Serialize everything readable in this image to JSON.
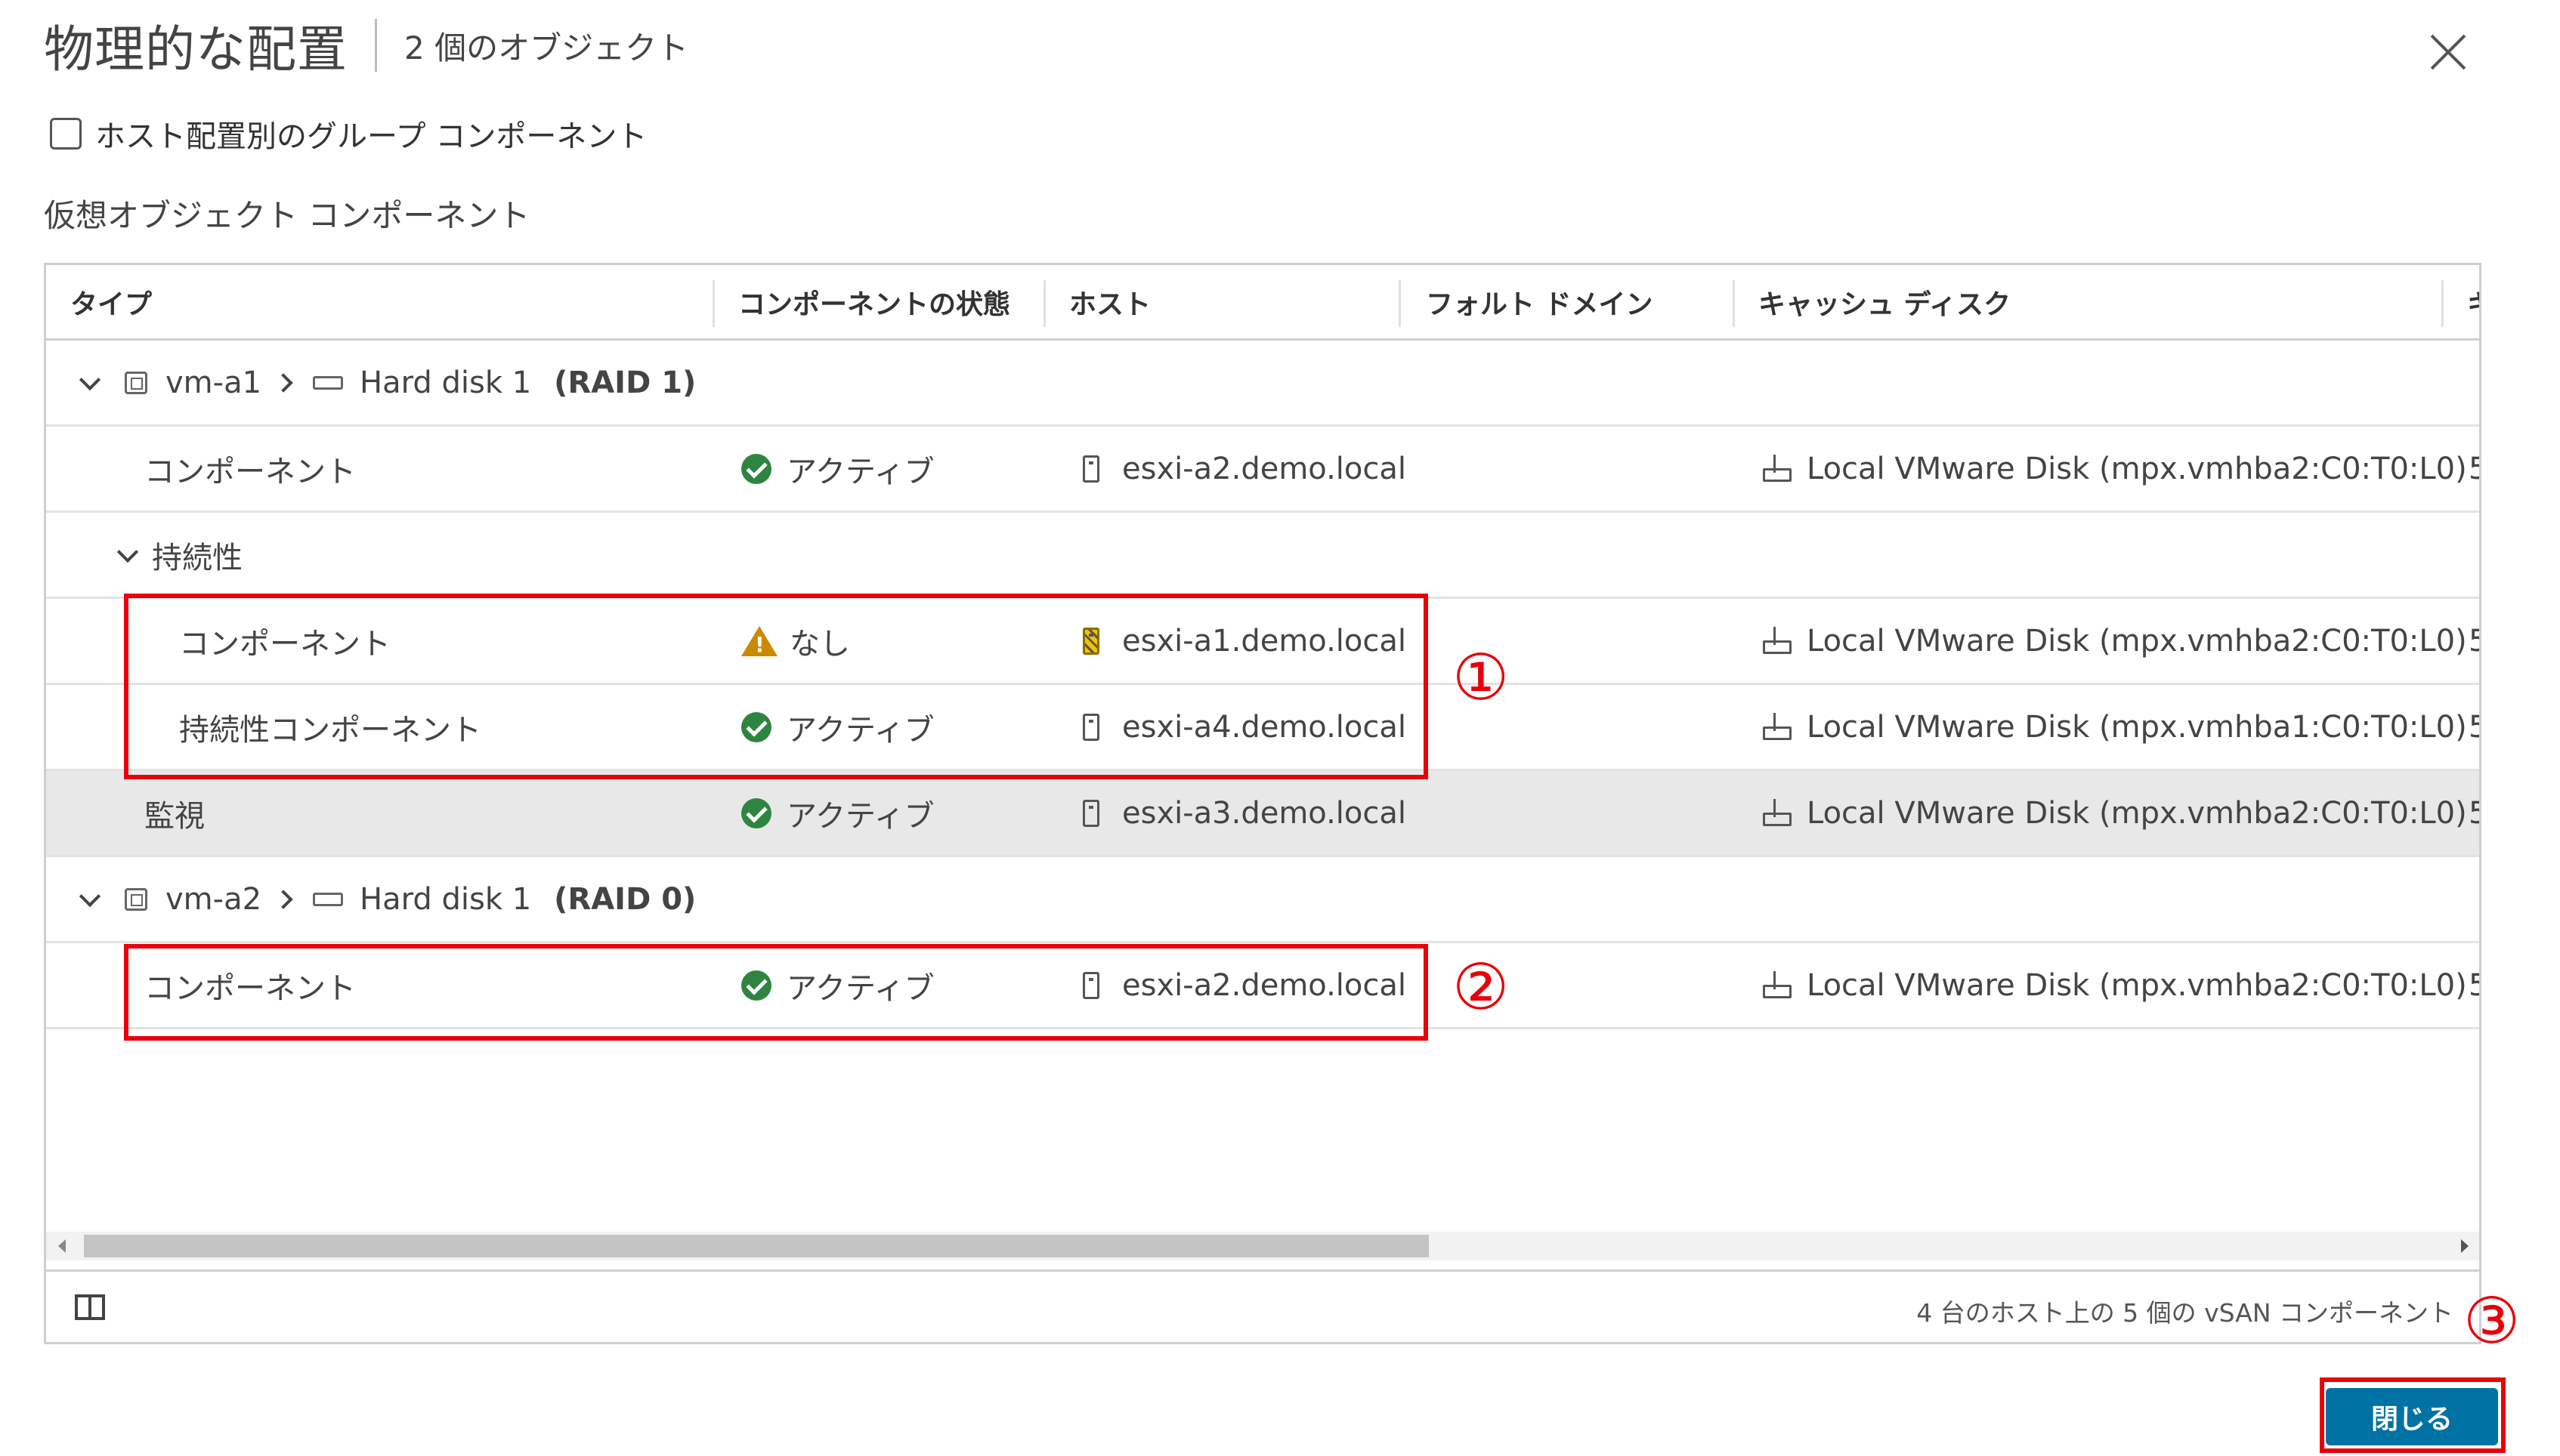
{
  "dialog": {
    "title": "物理的な配置",
    "subtitle": "2 個のオブジェクト",
    "group_by_host_label": "ホスト配置別のグループ コンポーネント",
    "section_label": "仮想オブジェクト コンポーネント",
    "close_button": "閉じる"
  },
  "table": {
    "columns": [
      "タイプ",
      "コンポーネントの状態",
      "ホスト",
      "フォルト ドメイン",
      "キャッシュ ディスク",
      "キ"
    ],
    "groups": [
      {
        "vm": "vm-a1",
        "disk": "Hard disk 1",
        "raid": "(RAID 1)",
        "rows": [
          {
            "type": "コンポーネント",
            "state": "アクティブ",
            "host": "esxi-a2.demo.local",
            "fault_domain": "",
            "cache_disk": "Local VMware Disk (mpx.vmhba2:C0:T0:L0)",
            "extra": "5"
          }
        ],
        "subgroup": {
          "label": "持続性",
          "rows": [
            {
              "type": "コンポーネント",
              "state": "なし",
              "host": "esxi-a1.demo.local",
              "fault_domain": "",
              "cache_disk": "Local VMware Disk (mpx.vmhba2:C0:T0:L0)",
              "extra": "5"
            },
            {
              "type": "持続性コンポーネント",
              "state": "アクティブ",
              "host": "esxi-a4.demo.local",
              "fault_domain": "",
              "cache_disk": "Local VMware Disk (mpx.vmhba1:C0:T0:L0)",
              "extra": "5"
            }
          ]
        },
        "witness": {
          "type": "監視",
          "state": "アクティブ",
          "host": "esxi-a3.demo.local",
          "fault_domain": "",
          "cache_disk": "Local VMware Disk (mpx.vmhba2:C0:T0:L0)",
          "extra": "5"
        }
      },
      {
        "vm": "vm-a2",
        "disk": "Hard disk 1",
        "raid": "(RAID 0)",
        "rows": [
          {
            "type": "コンポーネント",
            "state": "アクティブ",
            "host": "esxi-a2.demo.local",
            "fault_domain": "",
            "cache_disk": "Local VMware Disk (mpx.vmhba2:C0:T0:L0)",
            "extra": "5"
          }
        ]
      }
    ],
    "footer_summary": "4 台のホスト上の 5 個の vSAN コンポーネント"
  },
  "annotations": [
    "①",
    "②",
    "③"
  ],
  "colors": {
    "annotation_red": "#e8000b",
    "status_ok": "#2e8540",
    "status_warn": "#c98a00",
    "primary_button": "#0072a3"
  }
}
